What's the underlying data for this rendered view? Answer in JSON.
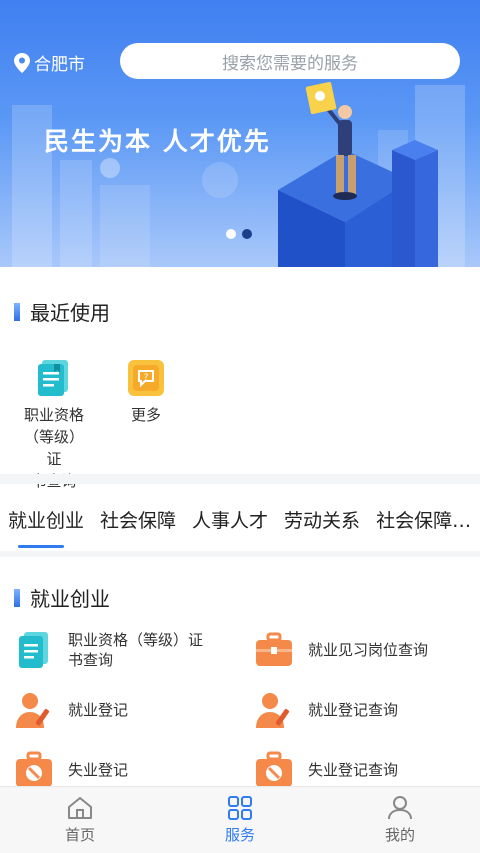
{
  "header": {
    "city": "合肥市",
    "search_placeholder": "搜索您需要的服务"
  },
  "banner": {
    "slogan": "民生为本 人才优先",
    "slide_count": 2,
    "active_slide": 2
  },
  "recent": {
    "title": "最近使用",
    "items": [
      {
        "label": "职业资格\n（等级）证\n书查询",
        "icon": "certificate-icon"
      },
      {
        "label": "更多",
        "icon": "more-icon"
      }
    ]
  },
  "tabs": [
    "就业创业",
    "社会保障",
    "人事人才",
    "劳动关系",
    "社会保障…"
  ],
  "active_tab": 0,
  "services": {
    "title": "就业创业",
    "items": [
      {
        "label": "职业资格（等级）证\n书查询",
        "icon": "certificate-icon"
      },
      {
        "label": "就业见习岗位查询",
        "icon": "briefcase-icon"
      },
      {
        "label": "就业登记",
        "icon": "person-edit-icon"
      },
      {
        "label": "就业登记查询",
        "icon": "person-edit-icon"
      },
      {
        "label": "失业登记",
        "icon": "bag-forbidden-icon"
      },
      {
        "label": "失业登记查询",
        "icon": "bag-forbidden-icon"
      }
    ]
  },
  "bottom_nav": [
    {
      "label": "首页",
      "icon": "home-icon"
    },
    {
      "label": "服务",
      "icon": "grid-icon"
    },
    {
      "label": "我的",
      "icon": "user-icon"
    }
  ],
  "active_nav": 1,
  "colors": {
    "accent": "#2f7bf0",
    "banner": "#4a88f2",
    "orange": "#f5894a",
    "cyan": "#2cc6d6"
  }
}
